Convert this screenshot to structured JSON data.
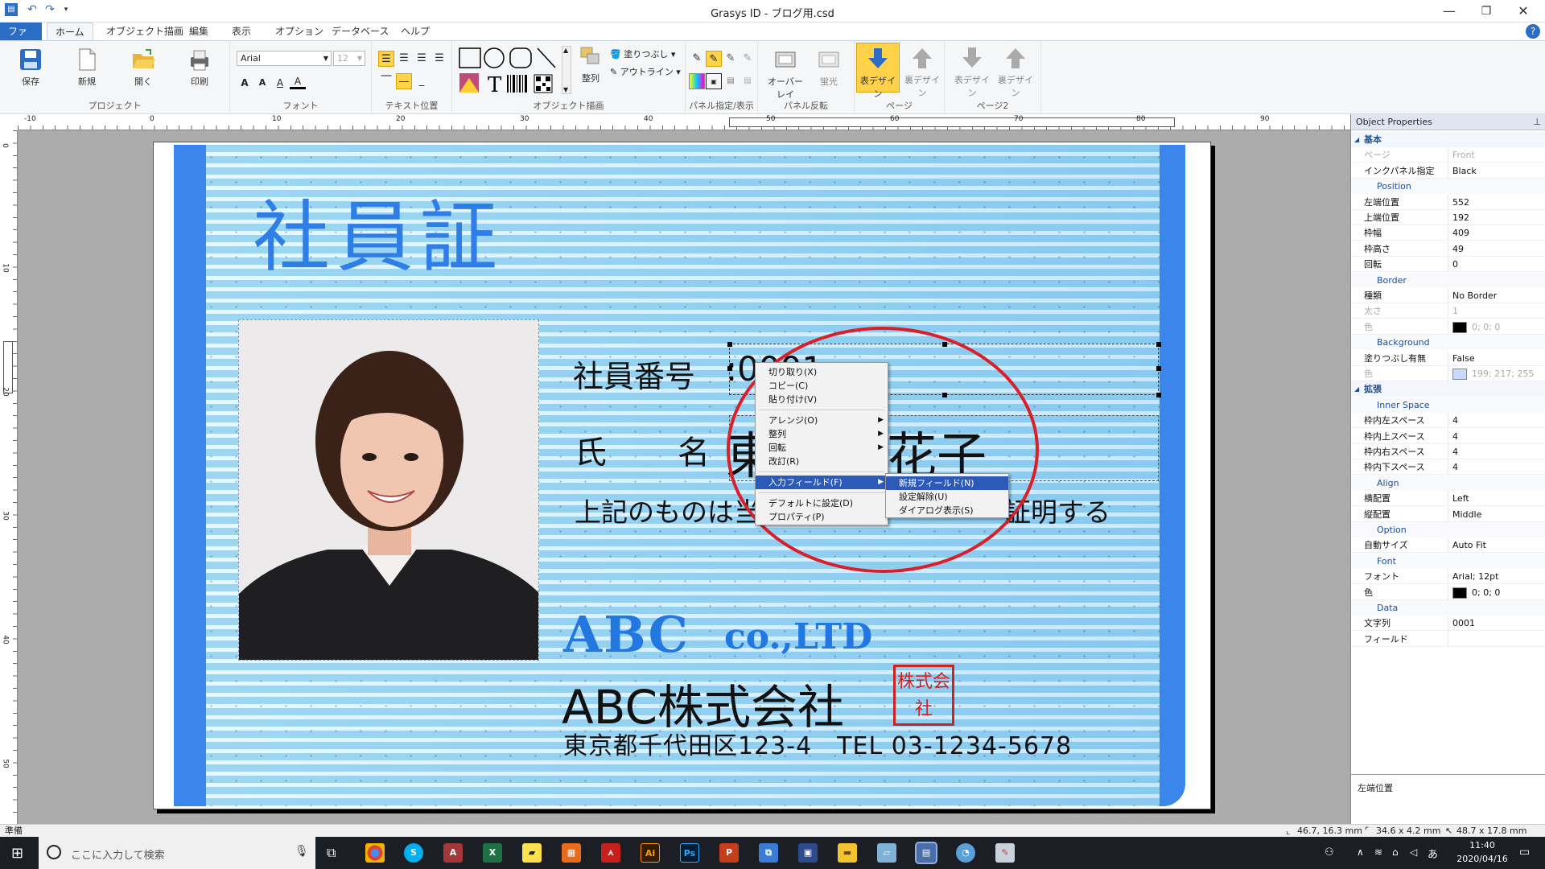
{
  "window": {
    "title": "Grasys ID - ブログ用.csd",
    "minimize": "—",
    "maximize": "❐",
    "close": "✕",
    "help": "?"
  },
  "ribbon": {
    "tabs": [
      "ファイル",
      "ホーム",
      "オブジェクト描画",
      "編集",
      "表示",
      "オプション",
      "データベース",
      "ヘルプ"
    ],
    "project": {
      "group": "プロジェクト",
      "save": "保存",
      "new": "新規",
      "open": "開く",
      "print": "印刷"
    },
    "font": {
      "group": "フォント",
      "family": "Arial",
      "size": "12"
    },
    "text_position": {
      "group": "テキスト位置"
    },
    "object_draw": {
      "group": "オブジェクト描画",
      "align": "整列",
      "fill": "塗りつぶし",
      "outline": "アウトライン"
    },
    "panel": {
      "group": "パネル指定/表示"
    },
    "panel_flip": {
      "group": "パネル反転",
      "overlay": "オーバーレイ",
      "fluorescent": "蛍光"
    },
    "page": {
      "group": "ページ",
      "front": "表デザイン",
      "back": "裏デザイン"
    },
    "page2": {
      "group": "ページ2",
      "front": "表デザイン",
      "back": "裏デザイン"
    }
  },
  "rulers": {
    "h_ticks": [
      "-10",
      "0",
      "10",
      "20",
      "30",
      "40",
      "50",
      "60",
      "70",
      "80",
      "90"
    ],
    "v_ticks": [
      "0",
      "10",
      "20",
      "30",
      "40",
      "50"
    ]
  },
  "card": {
    "title": "社員証",
    "emp_no_label": "社員番号",
    "emp_no_value": ":0001",
    "name_label_1": "氏",
    "name_label_2": "名",
    "name_value_1": "東",
    "name_value_2": "花子",
    "certify_1": "上記のものは当",
    "certify_2": "証明する",
    "logo_abc": "ABC",
    "logo_co": "co.,LTD",
    "company": "ABC株式会社",
    "address": "東京都千代田区123-4　TEL 03-1234-5678",
    "seal_text": "株式会社"
  },
  "context_menu": {
    "items": [
      "切り取り(X)",
      "コピー(C)",
      "貼り付け(V)",
      "アレンジ(O)",
      "整列",
      "回転",
      "改訂(R)",
      "入力フィールド(F)",
      "デフォルトに設定(D)",
      "プロパティ(P)"
    ],
    "submenu": [
      "新規フィールド(N)",
      "設定解除(U)",
      "ダイアログ表示(S)"
    ]
  },
  "properties": {
    "title": "Object Properties",
    "pin": "⊥",
    "rows": [
      {
        "type": "cat",
        "label": "基本"
      },
      {
        "type": "row",
        "key": "ページ",
        "value": "Front",
        "disabled": true
      },
      {
        "type": "row",
        "key": "インクパネル指定",
        "value": "Black"
      },
      {
        "type": "sub",
        "label": "Position"
      },
      {
        "type": "row",
        "key": "左端位置",
        "value": "552"
      },
      {
        "type": "row",
        "key": "上端位置",
        "value": "192"
      },
      {
        "type": "row",
        "key": "枠幅",
        "value": "409"
      },
      {
        "type": "row",
        "key": "枠高さ",
        "value": "49"
      },
      {
        "type": "row",
        "key": "回転",
        "value": "0"
      },
      {
        "type": "sub",
        "label": "Border"
      },
      {
        "type": "row",
        "key": "種類",
        "value": "No Border"
      },
      {
        "type": "row",
        "key": "太さ",
        "value": "1",
        "disabled": true
      },
      {
        "type": "color",
        "key": "色",
        "value": "0; 0; 0",
        "color": "#000000",
        "disabled": true
      },
      {
        "type": "sub",
        "label": "Background"
      },
      {
        "type": "row",
        "key": "塗りつぶし有無",
        "value": "False"
      },
      {
        "type": "color",
        "key": "色",
        "value": "199; 217; 255",
        "color": "#c7d9ff",
        "disabled": true
      },
      {
        "type": "cat",
        "label": "拡張"
      },
      {
        "type": "sub",
        "label": "Inner Space"
      },
      {
        "type": "row",
        "key": "枠内左スペース",
        "value": "4"
      },
      {
        "type": "row",
        "key": "枠内上スペース",
        "value": "4"
      },
      {
        "type": "row",
        "key": "枠内右スペース",
        "value": "4"
      },
      {
        "type": "row",
        "key": "枠内下スペース",
        "value": "4"
      },
      {
        "type": "sub",
        "label": "Align"
      },
      {
        "type": "row",
        "key": "横配置",
        "value": "Left"
      },
      {
        "type": "row",
        "key": "縦配置",
        "value": "Middle"
      },
      {
        "type": "sub",
        "label": "Option"
      },
      {
        "type": "row",
        "key": "自動サイズ",
        "value": "Auto Fit"
      },
      {
        "type": "sub",
        "label": "Font"
      },
      {
        "type": "row",
        "key": "フォント",
        "value": "Arial; 12pt"
      },
      {
        "type": "color",
        "key": "色",
        "value": "0; 0; 0",
        "color": "#000000"
      },
      {
        "type": "sub",
        "label": "Data"
      },
      {
        "type": "row",
        "key": "文字列",
        "value": "0001"
      },
      {
        "type": "row",
        "key": "フィールド",
        "value": ""
      }
    ],
    "description": "左端位置"
  },
  "status": {
    "left": "準備",
    "pos": "46.7, 16.3 mm",
    "size": "34.6 x 4.2 mm",
    "cursor": "48.7 x 17.8 mm"
  },
  "taskbar": {
    "search_placeholder": "ここに入力して検索",
    "time": "11:40",
    "date": "2020/04/16",
    "ime": "あ"
  },
  "colors": {
    "card_bar": "#3a86ec",
    "title_blue": "#2f7de6",
    "logo_blue": "#2277e0",
    "seal_red": "#cc2222",
    "ribbon_file": "#2b6cc4",
    "highlight": "#2b5ab9",
    "annotation_circle": "#d8202a"
  }
}
